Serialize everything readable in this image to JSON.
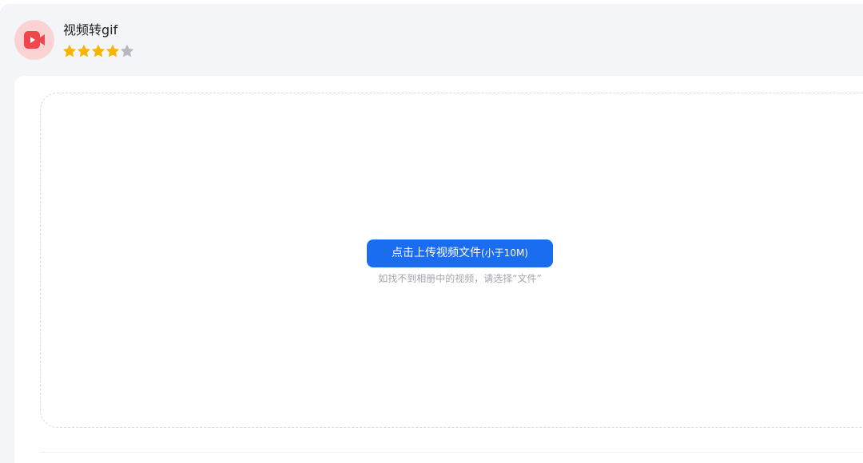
{
  "app": {
    "title": "视频转gif",
    "icon": "video-camera-icon",
    "rating": {
      "value": 4,
      "max": 5
    }
  },
  "upload": {
    "button_label": "点击上传视频文件",
    "button_limit": "(小于10M)",
    "hint": "如找不到相册中的视频，请选择“文件”"
  },
  "colors": {
    "accent": "#1a6cf0",
    "star_filled": "#f8b500",
    "star_empty": "#b5b8bf",
    "icon_red": "#f0474c",
    "icon_bg": "#fbd3d3"
  }
}
